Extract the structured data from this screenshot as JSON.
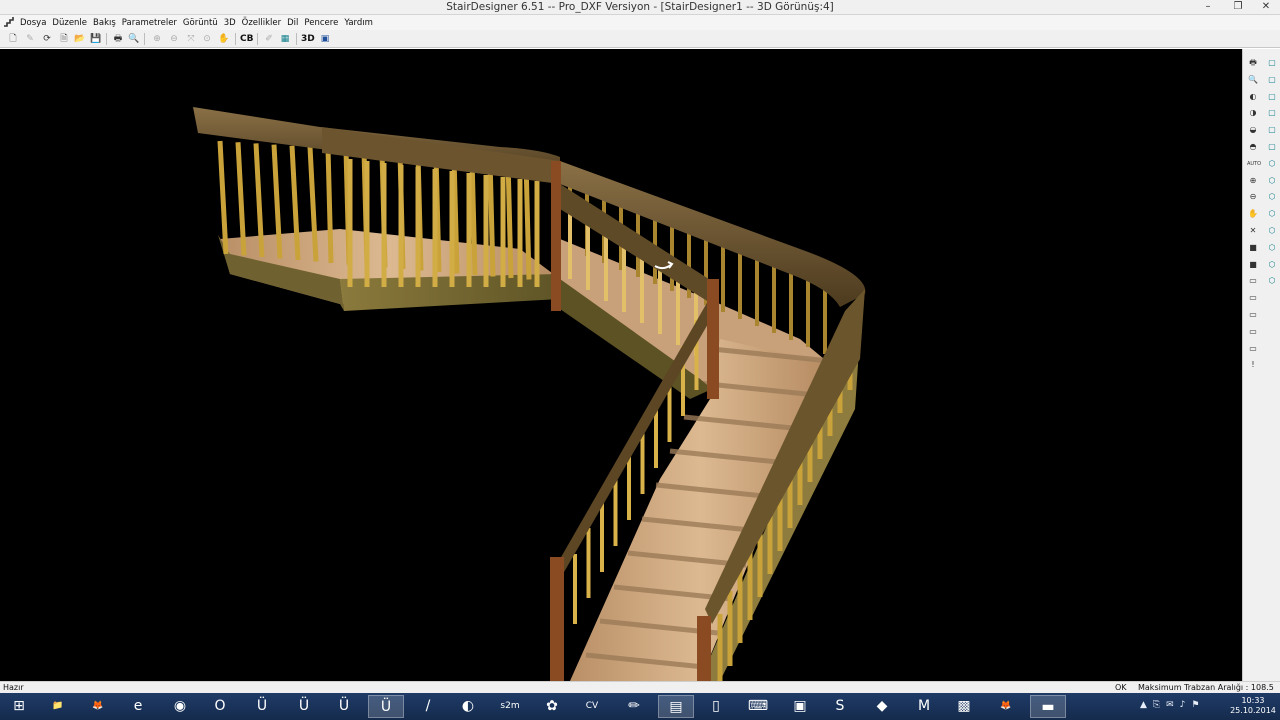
{
  "window": {
    "title": "StairDesigner 6.51 -- Pro_DXF Versiyon - [StairDesigner1 -- 3D Görünüş:4]",
    "controls": {
      "minimize": "–",
      "maximize": "❐",
      "close": "✕"
    }
  },
  "menu": {
    "items": [
      {
        "label": "Dosya"
      },
      {
        "label": "Düzenle"
      },
      {
        "label": "Bakış"
      },
      {
        "label": "Parametreler"
      },
      {
        "label": "Görüntü"
      },
      {
        "label": "3D"
      },
      {
        "label": "Özellikler"
      },
      {
        "label": "Dil"
      },
      {
        "label": "Pencere"
      },
      {
        "label": "Yardım"
      }
    ],
    "mdi": {
      "minimize": "–",
      "restore": "❐",
      "close": "✕"
    }
  },
  "toolbar": {
    "cb_label": "CB",
    "threed_label": "3D",
    "icons": {
      "new": "🗋",
      "draw": "✎",
      "rotate": "⟳",
      "open_recent": "🗎",
      "open": "📂",
      "save": "💾",
      "print": "🖶",
      "preview": "🔍",
      "zoom_in": "⊕",
      "zoom_out": "⊖",
      "zoom_all": "⤧",
      "zoom_window": "⊙",
      "pan": "✋",
      "pencil": "✐",
      "stair": "▦",
      "window": "▣"
    }
  },
  "right_toolbar": {
    "left_icons": [
      "🖶",
      "🔍",
      "◐",
      "◑",
      "◒",
      "◓",
      "AUTO",
      "⊕",
      "⊖",
      "✋",
      "✕",
      "■",
      "■",
      "▭",
      "▭",
      "▭",
      "▭",
      "▭",
      "!"
    ],
    "right_icons": [
      "▢",
      "▢",
      "▢",
      "▢",
      "▢",
      "▢",
      "⬡",
      "⬡",
      "⬡",
      "⬡",
      "⬡",
      "⬡",
      "⬡",
      "⬡"
    ]
  },
  "status": {
    "left": "Hazır",
    "ok": "OK",
    "right": "Maksimum Trabzan Aralığı : 108.5 mm"
  },
  "taskbar": {
    "start_icon": "⊞",
    "apps": [
      {
        "icon": "📁"
      },
      {
        "icon": "🦊"
      },
      {
        "icon": "e"
      },
      {
        "icon": "◉"
      },
      {
        "icon": "O"
      },
      {
        "icon": "Ü"
      },
      {
        "icon": "Ü"
      },
      {
        "icon": "Ü"
      },
      {
        "icon": "Ü"
      },
      {
        "icon": "/"
      },
      {
        "icon": "◐"
      },
      {
        "icon": "s2m"
      },
      {
        "icon": "✿"
      },
      {
        "icon": "CV"
      },
      {
        "icon": "✏"
      },
      {
        "icon": "▤"
      },
      {
        "icon": "▯"
      },
      {
        "icon": "⌨"
      },
      {
        "icon": "▣"
      },
      {
        "icon": "S"
      },
      {
        "icon": "◆"
      },
      {
        "icon": "M"
      },
      {
        "icon": "▩"
      },
      {
        "icon": "🦊"
      },
      {
        "icon": "▬"
      }
    ],
    "tray_icons": [
      "▲",
      "⎘",
      "✉",
      "♪",
      "⚑"
    ],
    "time": "10:33",
    "date": "25.10.2014"
  },
  "colors": {
    "viewport_bg": "#000000",
    "handrail": "#6e5630",
    "baluster": "#c9a23a",
    "tread": "#caa57c",
    "newel": "#8a4a22",
    "stringer": "#7a6a35"
  }
}
